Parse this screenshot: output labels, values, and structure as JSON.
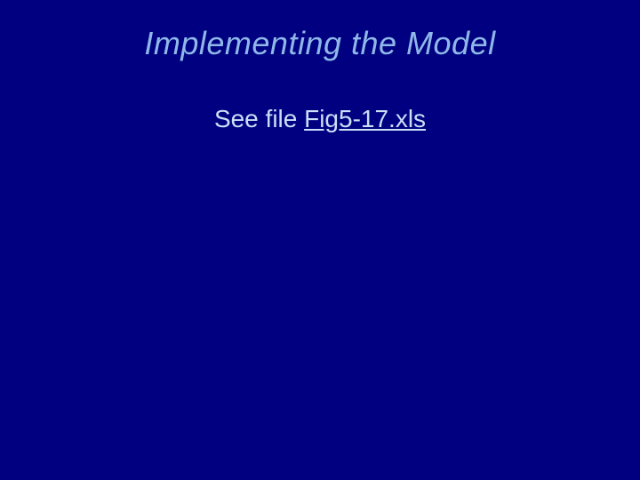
{
  "slide": {
    "title": "Implementing the Model",
    "body_prefix": "See file ",
    "file_link": "Fig5-17.xls"
  }
}
